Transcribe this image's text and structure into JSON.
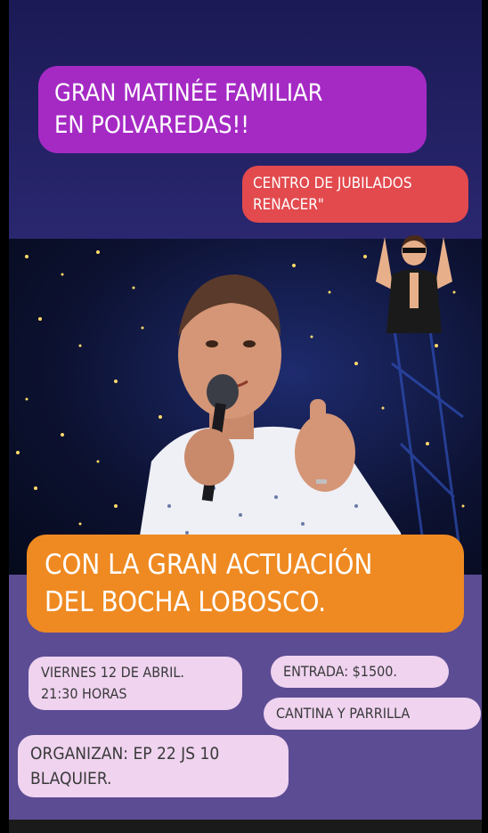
{
  "header": {
    "title_line1": "GRAN MATINÉE FAMILIAR",
    "title_line2": "EN POLVAREDAS!!"
  },
  "venue": {
    "line1": "CENTRO DE JUBILADOS",
    "line2": "RENACER\""
  },
  "headline": {
    "line1": "CON LA GRAN ACTUACIÓN",
    "line2": "DEL BOCHA LOBOSCO."
  },
  "details": {
    "date": "VIERNES 12 DE ABRIL.",
    "time": "21:30 HORAS",
    "entry": "ENTRADA: $1500.",
    "food": "CANTINA Y PARRILLA",
    "organizers_line1": "ORGANIZAN: EP 22 JS 10",
    "organizers_line2": "BLAQUIER."
  },
  "colors": {
    "title_pill": "#a52ac4",
    "venue_pill": "#e24a4e",
    "headline_pill": "#ef8a22",
    "info_pill": "#efd3ef",
    "background": "#1e1d5a",
    "lower_background": "#5c4c93"
  }
}
